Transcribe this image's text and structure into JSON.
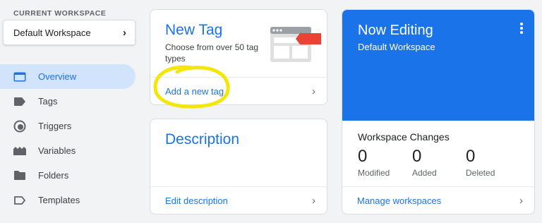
{
  "sidebar": {
    "workspace_label": "CURRENT WORKSPACE",
    "workspace_name": "Default Workspace",
    "items": [
      {
        "label": "Overview",
        "icon": "overview-icon",
        "active": true
      },
      {
        "label": "Tags",
        "icon": "tag-icon"
      },
      {
        "label": "Triggers",
        "icon": "trigger-icon"
      },
      {
        "label": "Variables",
        "icon": "variables-icon"
      },
      {
        "label": "Folders",
        "icon": "folder-icon"
      },
      {
        "label": "Templates",
        "icon": "template-icon"
      }
    ]
  },
  "new_tag_card": {
    "title": "New Tag",
    "description": "Choose from over 50 tag types",
    "link": "Add a new tag"
  },
  "description_card": {
    "title": "Description",
    "link": "Edit description"
  },
  "editing_card": {
    "title": "Now Editing",
    "workspace": "Default Workspace",
    "changes_heading": "Workspace Changes",
    "stats": [
      {
        "value": "0",
        "label": "Modified"
      },
      {
        "value": "0",
        "label": "Added"
      },
      {
        "value": "0",
        "label": "Deleted"
      }
    ],
    "link": "Manage workspaces"
  },
  "colors": {
    "accent": "#1a73e8",
    "active_nav_bg": "#d2e3fc",
    "annotation": "#f5e60a"
  }
}
